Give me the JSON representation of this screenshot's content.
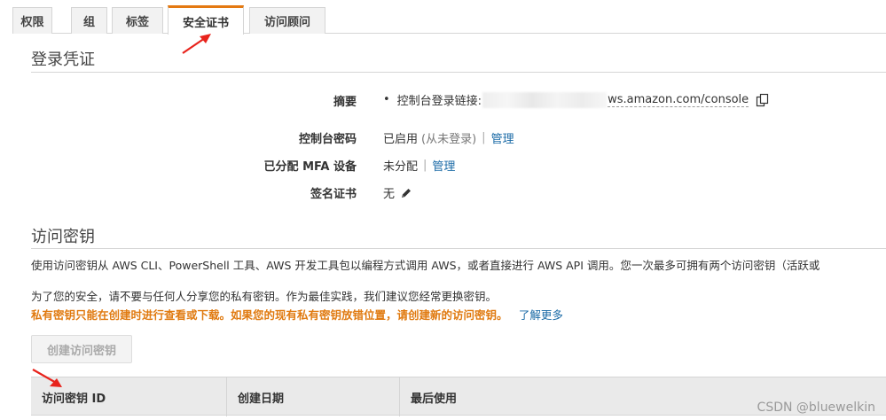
{
  "tabs": [
    {
      "label": "权限",
      "active": false
    },
    {
      "label": "组",
      "active": false
    },
    {
      "label": "标签",
      "active": false
    },
    {
      "label": "安全证书",
      "active": true
    },
    {
      "label": "访问顾问",
      "active": false
    }
  ],
  "login": {
    "title": "登录凭证",
    "summary_label": "摘要",
    "summary_prefix": "控制台登录链接:",
    "summary_url": "ws.amazon.com/console",
    "password_label": "控制台密码",
    "password_status": "已启用",
    "password_note": "(从未登录)",
    "password_manage": "管理",
    "mfa_label": "已分配 MFA 设备",
    "mfa_status": "未分配",
    "mfa_manage": "管理",
    "cert_label": "签名证书",
    "cert_value": "无"
  },
  "access_keys": {
    "title": "访问密钥",
    "description": "使用访问密钥从 AWS CLI、PowerShell 工具、AWS 开发工具包以编程方式调用 AWS，或者直接进行 AWS API 调用。您一次最多可拥有两个访问密钥（活跃或",
    "security_note": "为了您的安全，请不要与任何人分享您的私有密钥。作为最佳实践，我们建议您经常更换密钥。",
    "warning": "私有密钥只能在创建时进行查看或下载。如果您的现有私有密钥放错位置，请创建新的访问密钥。",
    "learn_more": "了解更多",
    "create_button": "创建访问密钥",
    "columns": [
      "访问密钥 ID",
      "创建日期",
      "最后使用"
    ]
  },
  "watermark": "CSDN @bluewelkin",
  "colors": {
    "accent_tab": "#e47911",
    "link": "#1a6aa6",
    "warning": "#e07a10",
    "arrow": "#e8231c"
  }
}
